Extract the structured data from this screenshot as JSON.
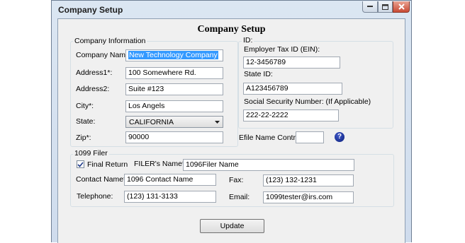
{
  "window": {
    "title": "Company Setup",
    "heading": "Company Setup"
  },
  "company_info": {
    "group_label": "Company Information",
    "name_label": "Company Name*:",
    "name_value": "New Technology Company",
    "address1_label": "Address1*:",
    "address1_value": "100 Somewhere Rd.",
    "address2_label": "Address2:",
    "address2_value": "Suite #123",
    "city_label": "City*:",
    "city_value": "Los Angels",
    "state_label": "State:",
    "state_value": "CALIFORNIA",
    "zip_label": "Zip*:",
    "zip_value": "90000"
  },
  "id_info": {
    "group_label": "ID:",
    "ein_label": "Employer Tax ID (EIN):",
    "ein_value": "12-3456789",
    "state_id_label": "State ID:",
    "state_id_value": "A123456789",
    "ssn_label": "Social Security Number: (If Applicable)",
    "ssn_value": "222-22-2222"
  },
  "efile": {
    "label": "Efile Name Control:",
    "value": "",
    "help": "?"
  },
  "filer": {
    "group_label": "1099 Filer",
    "final_return_label": "Final Return",
    "final_return_checked": true,
    "filer_name_label": "FILER's Name*:",
    "filer_name_value": "1096Filer  Name",
    "contact_label": "Contact Name*:",
    "contact_value": "1096 Contact Name",
    "fax_label": "Fax:",
    "fax_value": "(123) 132-1231",
    "telephone_label": "Telephone:",
    "telephone_value": "(123) 131-3133",
    "email_label": "Email:",
    "email_value": "1099tester@irs.com"
  },
  "update_button": "Update"
}
